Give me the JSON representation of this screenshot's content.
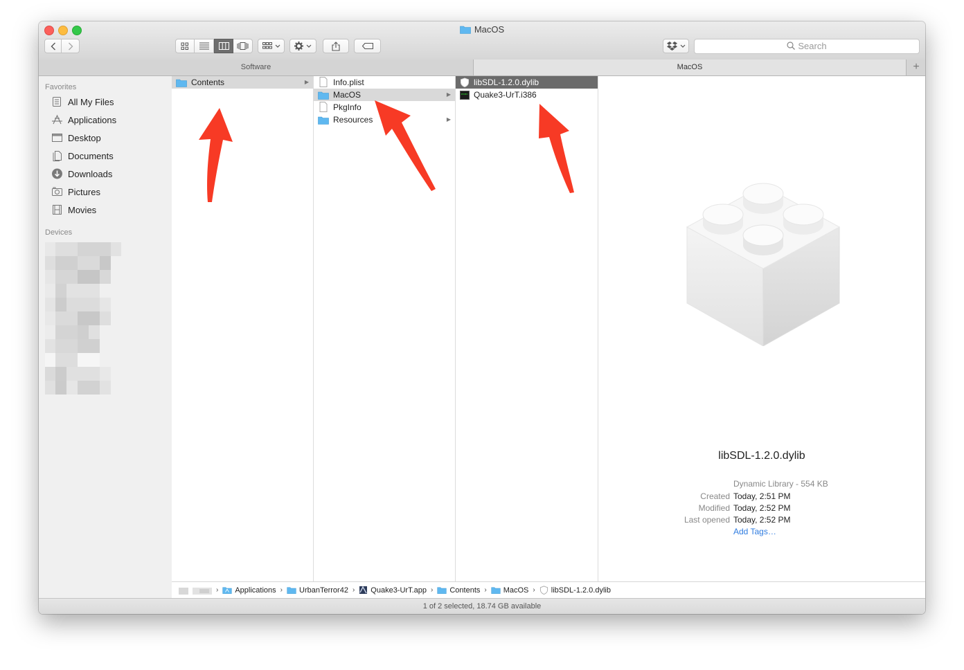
{
  "window": {
    "title": "MacOS"
  },
  "toolbar": {
    "search_placeholder": "Search"
  },
  "tabs": [
    {
      "label": "Software"
    },
    {
      "label": "MacOS"
    }
  ],
  "sidebar": {
    "favorites_header": "Favorites",
    "devices_header": "Devices",
    "items": [
      {
        "label": "All My Files",
        "icon": "all-files-icon"
      },
      {
        "label": "Applications",
        "icon": "applications-icon"
      },
      {
        "label": "Desktop",
        "icon": "desktop-icon"
      },
      {
        "label": "Documents",
        "icon": "documents-icon"
      },
      {
        "label": "Downloads",
        "icon": "downloads-icon"
      },
      {
        "label": "Pictures",
        "icon": "pictures-icon"
      },
      {
        "label": "Movies",
        "icon": "movies-icon"
      }
    ]
  },
  "columns": {
    "col1": [
      {
        "label": "Contents",
        "type": "folder"
      }
    ],
    "col2": [
      {
        "label": "Info.plist",
        "type": "file"
      },
      {
        "label": "MacOS",
        "type": "folder"
      },
      {
        "label": "PkgInfo",
        "type": "file"
      },
      {
        "label": "Resources",
        "type": "folder"
      }
    ],
    "col3": [
      {
        "label": "libSDL-1.2.0.dylib",
        "type": "dylib"
      },
      {
        "label": "Quake3-UrT.i386",
        "type": "exec"
      }
    ]
  },
  "preview": {
    "name": "libSDL-1.2.0.dylib",
    "kind": "Dynamic Library - 554 KB",
    "created_label": "Created",
    "created": "Today, 2:51 PM",
    "modified_label": "Modified",
    "modified": "Today, 2:52 PM",
    "opened_label": "Last opened",
    "opened": "Today, 2:52 PM",
    "add_tags": "Add Tags…"
  },
  "pathbar": [
    {
      "label": "Applications"
    },
    {
      "label": "UrbanTerror42"
    },
    {
      "label": "Quake3-UrT.app"
    },
    {
      "label": "Contents"
    },
    {
      "label": "MacOS"
    },
    {
      "label": "libSDL-1.2.0.dylib"
    }
  ],
  "status": {
    "text": "1 of 2 selected, 18.74 GB available"
  },
  "colors": {
    "arrow": "#f73a25",
    "folder": "#5fb8f0",
    "link": "#2f7ce0"
  }
}
